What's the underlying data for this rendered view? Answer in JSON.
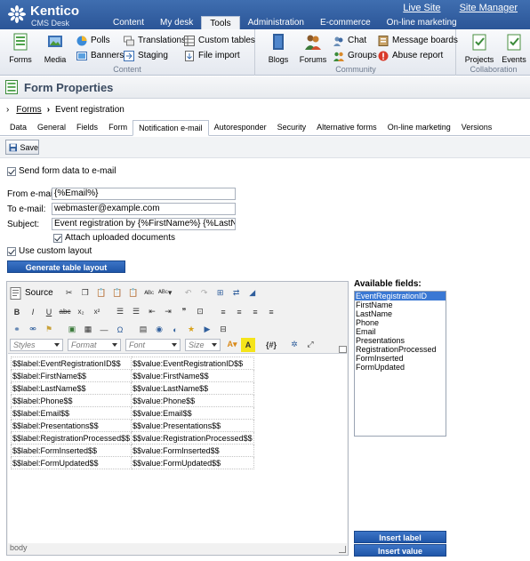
{
  "app": {
    "logo_name": "Kentico",
    "logo_sub": "CMS Desk",
    "top_links": [
      "Live Site",
      "Site Manager"
    ],
    "main_tabs": [
      {
        "label": "Content",
        "active": false
      },
      {
        "label": "My desk",
        "active": false
      },
      {
        "label": "Tools",
        "active": true
      },
      {
        "label": "Administration",
        "active": false
      },
      {
        "label": "E-commerce",
        "active": false
      },
      {
        "label": "On-line marketing",
        "active": false
      }
    ]
  },
  "ribbon": {
    "content_group": "Content",
    "community_group": "Community",
    "collaboration_group": "Collaboration",
    "forms": "Forms",
    "media": "Media",
    "polls": "Polls",
    "banners": "Banners",
    "translations": "Translations",
    "staging": "Staging",
    "custom_tables": "Custom tables",
    "file_import": "File import",
    "blogs": "Blogs",
    "forums": "Forums",
    "chat": "Chat",
    "groups": "Groups",
    "message_boards": "Message boards",
    "abuse_report": "Abuse report",
    "projects": "Projects",
    "events": "Events"
  },
  "page": {
    "title": "Form Properties",
    "breadcrumb_link": "Forms",
    "breadcrumb_current": "Event registration"
  },
  "sub_tabs": [
    {
      "label": "Data",
      "active": false
    },
    {
      "label": "General",
      "active": false
    },
    {
      "label": "Fields",
      "active": false
    },
    {
      "label": "Form",
      "active": false
    },
    {
      "label": "Notification e-mail",
      "active": true
    },
    {
      "label": "Autoresponder",
      "active": false
    },
    {
      "label": "Security",
      "active": false
    },
    {
      "label": "Alternative forms",
      "active": false
    },
    {
      "label": "On-line marketing",
      "active": false
    },
    {
      "label": "Versions",
      "active": false
    }
  ],
  "toolbar": {
    "save_label": "Save"
  },
  "form": {
    "send_label": "Send form data to e-mail",
    "send_checked": true,
    "from_label": "From e-mail:",
    "from_value": "{%Email%}",
    "to_label": "To e-mail:",
    "to_value": "webmaster@example.com",
    "subject_label": "Subject:",
    "subject_value": "Event registration by {%FirstName%} {%LastName%}",
    "attach_label": "Attach uploaded documents",
    "attach_checked": true,
    "custom_layout_label": "Use custom layout",
    "custom_layout_checked": true,
    "generate_label": "Generate table layout"
  },
  "editor": {
    "source_label": "Source",
    "styles": "Styles",
    "format": "Format",
    "font": "Font",
    "size": "Size",
    "status_path": "body",
    "rows": [
      [
        "$$label:EventRegistrationID$$",
        "$$value:EventRegistrationID$$"
      ],
      [
        "$$label:FirstName$$",
        "$$value:FirstName$$"
      ],
      [
        "$$label:LastName$$",
        "$$value:LastName$$"
      ],
      [
        "$$label:Phone$$",
        "$$value:Phone$$"
      ],
      [
        "$$label:Email$$",
        "$$value:Email$$"
      ],
      [
        "$$label:Presentations$$",
        "$$value:Presentations$$"
      ],
      [
        "$$label:RegistrationProcessed$$",
        "$$value:RegistrationProcessed$$"
      ],
      [
        "$$label:FormInserted$$",
        "$$value:FormInserted$$"
      ],
      [
        "$$label:FormUpdated$$",
        "$$value:FormUpdated$$"
      ]
    ]
  },
  "available_fields": {
    "label": "Available fields:",
    "items": [
      "EventRegistrationID",
      "FirstName",
      "LastName",
      "Phone",
      "Email",
      "Presentations",
      "RegistrationProcessed",
      "FormInserted",
      "FormUpdated"
    ],
    "selected_index": 0,
    "insert_label": "Insert label",
    "insert_value": "Insert value"
  }
}
